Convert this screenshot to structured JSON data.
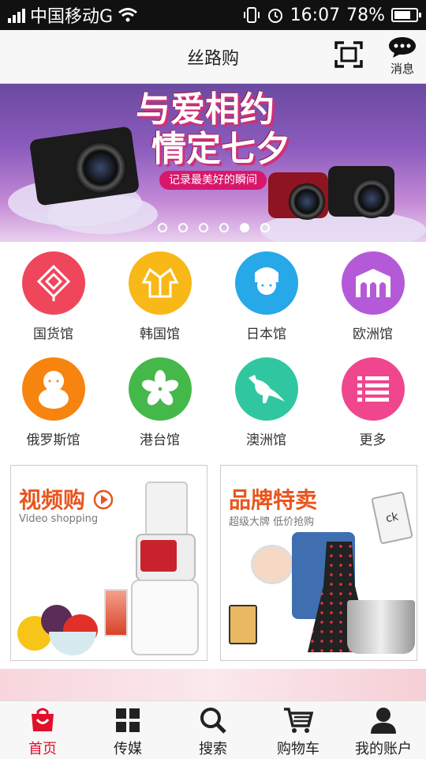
{
  "status": {
    "carrier": "中国移动G",
    "time": "16:07",
    "battery": "78%",
    "battery_level": 0.78
  },
  "header": {
    "title": "丝路购",
    "message_label": "消息",
    "scan_icon": "scan-icon",
    "message_icon": "chat-bubble-icon"
  },
  "banner": {
    "line1": "与爱相约",
    "line2": "情定七夕",
    "tagline": "记录最美好的瞬间",
    "slide_count": 6,
    "active_slide": 5
  },
  "categories": [
    {
      "label": "国货馆",
      "icon": "chinese-knot-icon",
      "color": "#f0465c"
    },
    {
      "label": "韩国馆",
      "icon": "hanbok-icon",
      "color": "#f8b818"
    },
    {
      "label": "日本馆",
      "icon": "geisha-icon",
      "color": "#27a8e8"
    },
    {
      "label": "欧洲馆",
      "icon": "gate-icon",
      "color": "#b45ad8"
    },
    {
      "label": "俄罗斯馆",
      "icon": "matryoshka-icon",
      "color": "#f7840f"
    },
    {
      "label": "港台馆",
      "icon": "bauhinia-icon",
      "color": "#45b84a"
    },
    {
      "label": "澳洲馆",
      "icon": "kangaroo-icon",
      "color": "#30c7a0"
    },
    {
      "label": "更多",
      "icon": "list-icon",
      "color": "#f0468d"
    }
  ],
  "promos": [
    {
      "title": "视频购",
      "subtitle": "Video shopping"
    },
    {
      "title": "品牌特卖",
      "subtitle": "超级大牌 低价抢购"
    }
  ],
  "tabs": [
    {
      "label": "首页",
      "icon": "shopping-bag-icon",
      "active": true
    },
    {
      "label": "传媒",
      "icon": "grid-icon",
      "active": false
    },
    {
      "label": "搜索",
      "icon": "search-icon",
      "active": false
    },
    {
      "label": "购物车",
      "icon": "cart-icon",
      "active": false
    },
    {
      "label": "我的账户",
      "icon": "user-icon",
      "active": false
    }
  ],
  "colors": {
    "accent": "#e0102b",
    "promo_title": "#e8551e"
  }
}
